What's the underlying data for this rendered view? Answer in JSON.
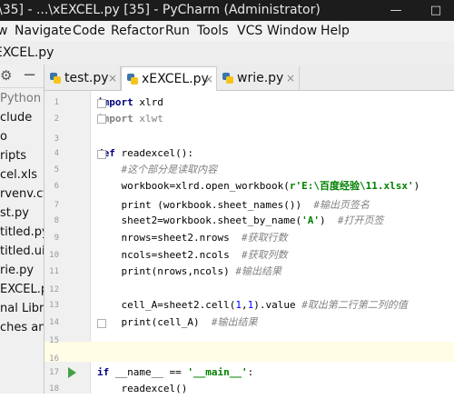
{
  "window": {
    "title": "\\35] - ...\\xEXCEL.py [35] - PyCharm (Administrator)",
    "min_symbol": "—",
    "max_symbol": "□"
  },
  "menu": [
    "w",
    "Navigate",
    "Code",
    "Refactor",
    "Run",
    "Tools",
    "VCS",
    "Window",
    "Help"
  ],
  "nav": {
    "file": "EXCEL.py"
  },
  "project": {
    "items": [
      "Python",
      "clude",
      "o",
      "ripts",
      "cel.xls",
      "rvenv.cfg",
      "st.py",
      "titled.py",
      "titled.ui",
      "rie.py",
      "EXCEL.py",
      "nal Libra",
      "ches and"
    ]
  },
  "tabs": [
    {
      "label": "test.py",
      "close": "×"
    },
    {
      "label": "xEXCEL.py",
      "close": "×"
    },
    {
      "label": "wrie.py",
      "close": "×"
    }
  ],
  "code": {
    "line1": {
      "no": "1",
      "kw": "import",
      "rest": " xlrd"
    },
    "line2": {
      "no": "2",
      "kw": "import",
      "rest": " xlwt"
    },
    "line3": {
      "no": "3"
    },
    "line4": {
      "no": "4",
      "kw": "def",
      "rest": " readexcel():"
    },
    "line5": {
      "no": "5",
      "comment": "#这个部分是读取内容"
    },
    "line6": {
      "no": "6",
      "pre": "    workbook=xlrd.open_workbook(",
      "str": "r'E:\\百度经验\\11.xlsx'",
      "post": ")"
    },
    "line7": {
      "no": "7",
      "pre": "    print (workbook.sheet_names())  ",
      "comment": "#输出页签名"
    },
    "line8": {
      "no": "8",
      "pre": "    sheet2=workbook.sheet_by_name(",
      "str": "'A'",
      "post": ")  ",
      "comment": "#打开页签"
    },
    "line9": {
      "no": "9",
      "pre": "    nrows=sheet2.nrows  ",
      "comment": "#获取行数"
    },
    "line10": {
      "no": "10",
      "pre": "    ncols=sheet2.ncols  ",
      "comment": "#获取列数"
    },
    "line11": {
      "no": "11",
      "pre": "    print(nrows,ncols) ",
      "comment": "#输出结果"
    },
    "line12": {
      "no": "12"
    },
    "line13": {
      "no": "13",
      "pre": "    cell_A=sheet2.cell(",
      "n1": "1",
      "mid": ",",
      "n2": "1",
      "post": ").value ",
      "comment": "#取出第二行第二列的值"
    },
    "line14": {
      "no": "14",
      "pre": "    print(cell_A)  ",
      "comment": "#输出结果"
    },
    "line15": {
      "no": "15"
    },
    "line16": {
      "no": "16"
    },
    "line17": {
      "no": "17",
      "kw": "if",
      "pre": " __name__ == ",
      "str": "'__main__'",
      "post": ":"
    },
    "line18": {
      "no": "18",
      "pre": "    readexcel()"
    }
  },
  "colors": {
    "python_icon_blue": "#3a75b0",
    "python_icon_yellow": "#f5c518",
    "run_arrow": "#46a046"
  }
}
